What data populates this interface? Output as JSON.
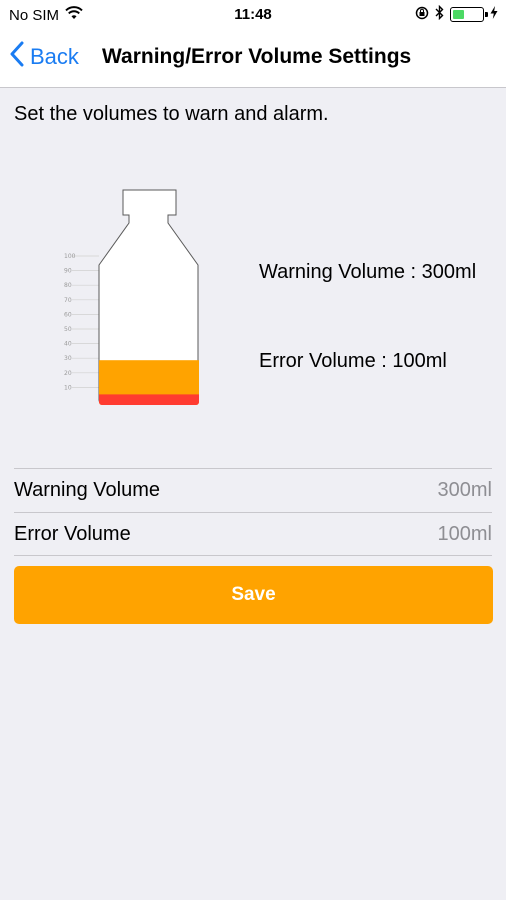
{
  "status_bar": {
    "carrier": "No SIM",
    "time": "11:48"
  },
  "nav": {
    "back_label": "Back",
    "title": "Warning/Error Volume Settings"
  },
  "intro_text": "Set the volumes to warn and alarm.",
  "bottle": {
    "scale_ticks": [
      "100",
      "90",
      "80",
      "70",
      "60",
      "50",
      "40",
      "30",
      "20",
      "10"
    ],
    "warning_level_percent": 30,
    "error_level_percent": 10,
    "colors": {
      "warning": "#ffa300",
      "error": "#ff3b30",
      "bottle_fill": "#ffffff",
      "bottle_outline": "#5a5a5a"
    }
  },
  "info": {
    "warning_text": "Warning Volume : 300ml",
    "error_text": "Error Volume : 100ml"
  },
  "settings": {
    "warning": {
      "label": "Warning Volume",
      "value": "300ml"
    },
    "error": {
      "label": "Error Volume",
      "value": "100ml"
    }
  },
  "save_label": "Save",
  "colors": {
    "accent": "#ffa300",
    "link": "#1a7cf2",
    "background": "#efeff4"
  }
}
